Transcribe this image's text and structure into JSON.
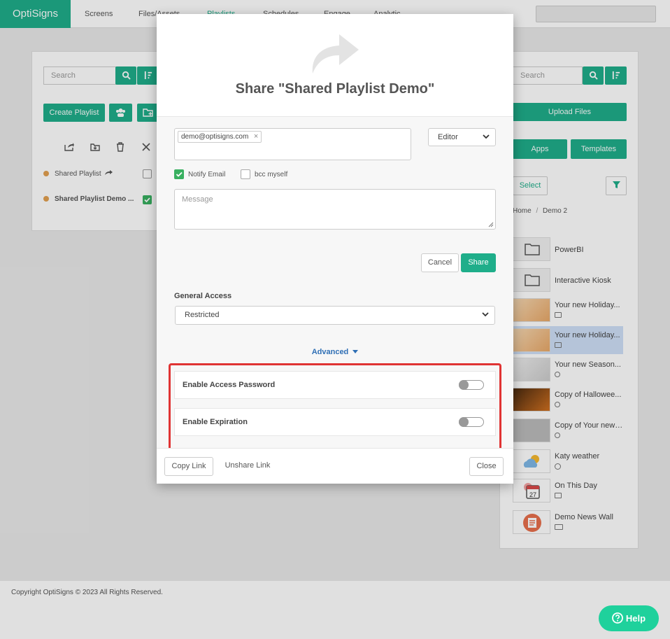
{
  "topnav": {
    "brand": "OptiSigns",
    "items": [
      "Screens",
      "Files/Assets",
      "Playlists",
      "Schedules",
      "Engage",
      "Analytic"
    ]
  },
  "left_panel": {
    "search_placeholder": "Search",
    "create_label": "Create Playlist",
    "rows": [
      {
        "label": "Shared Playlist",
        "checked": false
      },
      {
        "label": "Shared Playlist Demo ...",
        "checked": true
      }
    ]
  },
  "right_panel": {
    "search_placeholder": "Search",
    "upload_label": "Upload Files",
    "apps_label": "Apps",
    "templates_label": "Templates",
    "select_label": "Select",
    "breadcrumb": [
      "Home",
      "Demo 2"
    ],
    "items": [
      {
        "label": "PowerBI",
        "kind": "folder"
      },
      {
        "label": "Interactive Kiosk",
        "kind": "folder"
      },
      {
        "label": "Your new Holiday...",
        "kind": "image"
      },
      {
        "label": "Your new Holiday...",
        "kind": "image",
        "selected": true
      },
      {
        "label": "Your new Season...",
        "kind": "gear"
      },
      {
        "label": "Copy of Hallowee...",
        "kind": "gear"
      },
      {
        "label": "Copy of Your new ...",
        "kind": "gear"
      },
      {
        "label": "Katy weather",
        "kind": "sun"
      },
      {
        "label": "On This Day",
        "kind": "calendar"
      },
      {
        "label": "Demo News Wall",
        "kind": "news"
      }
    ]
  },
  "modal": {
    "title": "Share \"Shared Playlist Demo\"",
    "email_tag": "demo@optisigns.com",
    "email_remove": "×",
    "role": "Editor",
    "notify_label": "Notify Email",
    "notify_checked": true,
    "bcc_label": "bcc myself",
    "bcc_checked": false,
    "message_placeholder": "Message",
    "cancel_label": "Cancel",
    "share_label": "Share",
    "general_access_label": "General Access",
    "general_access_value": "Restricted",
    "advanced_label": "Advanced",
    "options": [
      {
        "label": "Enable Access Password",
        "enabled": false
      },
      {
        "label": "Enable Expiration",
        "enabled": false
      }
    ],
    "copy_link_label": "Copy Link",
    "unshare_label": "Unshare Link",
    "close_label": "Close"
  },
  "footer": {
    "copyright": "Copyright OptiSigns © 2023 All Rights Reserved."
  },
  "help_label": "Help",
  "colors": {
    "brand": "#1fae8a",
    "link": "#2f6fb5",
    "highlight": "#e03434",
    "help": "#1fd19c"
  }
}
